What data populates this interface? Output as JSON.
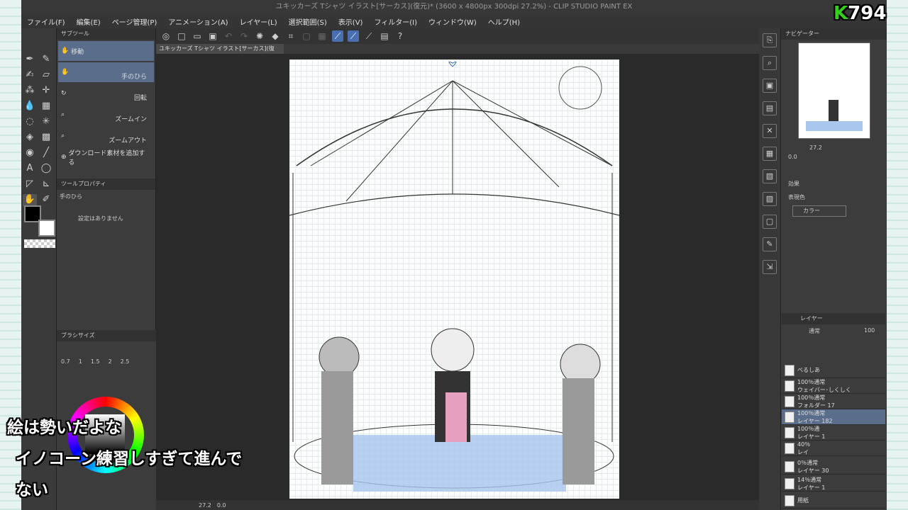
{
  "window": {
    "title": "ユキッカーズ Tシャツ イラスト[サーカス](復元)* (3600 x 4800px 300dpi 27.2%) - CLIP STUDIO PAINT EX"
  },
  "menu": [
    "ファイル(F)",
    "編集(E)",
    "ページ管理(P)",
    "アニメーション(A)",
    "レイヤー(L)",
    "選択範囲(S)",
    "表示(V)",
    "フィルター(I)",
    "ウィンドウ(W)",
    "ヘルプ(H)"
  ],
  "document_tab": "ユキッカーズ Tシャツ イラスト[サーカス](復元)*",
  "subtool": {
    "header": "サブツール",
    "items": [
      {
        "label": "移動",
        "sublabel": "",
        "selected": false
      },
      {
        "label": "",
        "sublabel": "手のひら",
        "selected": true
      },
      {
        "label": "",
        "sublabel": "回転",
        "selected": false
      },
      {
        "label": "",
        "sublabel": "ズームイン",
        "selected": false
      },
      {
        "label": "",
        "sublabel": "ズームアウト",
        "selected": false
      }
    ],
    "add_material": "ダウンロード素材を追加する"
  },
  "tool_property": {
    "header": "ツールプロパティ",
    "tool_name": "手のひら",
    "empty_text": "設定はありません"
  },
  "brush_size": {
    "header": "ブラシサイズ",
    "values": [
      "0.7",
      "1",
      "1.5",
      "2",
      "2.5"
    ]
  },
  "navigator": {
    "header": "ナビゲーター",
    "zoom": "27.2",
    "rotation": "0.0"
  },
  "layer_property": {
    "effect_label": "効果",
    "color_label": "表現色",
    "color_value": "カラー"
  },
  "layer_panel": {
    "header": "レイヤー",
    "blend": "通常",
    "opacity": "100",
    "rows": [
      {
        "line1": "",
        "line2": "べるしあ",
        "selected": false
      },
      {
        "line1": "100％通常",
        "line2": "ウェイバー･しくしく",
        "selected": false
      },
      {
        "line1": "100％通常",
        "line2": "フォルダー 17",
        "selected": false
      },
      {
        "line1": "100％通常",
        "line2": "レイヤー 182",
        "selected": true
      },
      {
        "line1": "100％通",
        "line2": "レイヤー 1",
        "selected": false
      },
      {
        "line1": "40％",
        "line2": "レイ",
        "selected": false
      },
      {
        "line1": "0％通常",
        "line2": "レイヤー 30",
        "selected": false
      },
      {
        "line1": "14％通常",
        "line2": "レイヤー 1",
        "selected": false
      },
      {
        "line1": "",
        "line2": "用紙",
        "selected": false
      }
    ]
  },
  "status": {
    "zoom": "27.2",
    "angle": "0.0"
  },
  "overlay": {
    "logo_letter": "K",
    "logo_number": "794",
    "caption_lines": [
      "絵は勢いだよな",
      "イノコーン練習しすぎて進んで",
      "ない"
    ]
  },
  "colors": {
    "accent": "#5a6e8c",
    "logo_green": "#32d21b",
    "canvas_bg": "#ffffff"
  }
}
